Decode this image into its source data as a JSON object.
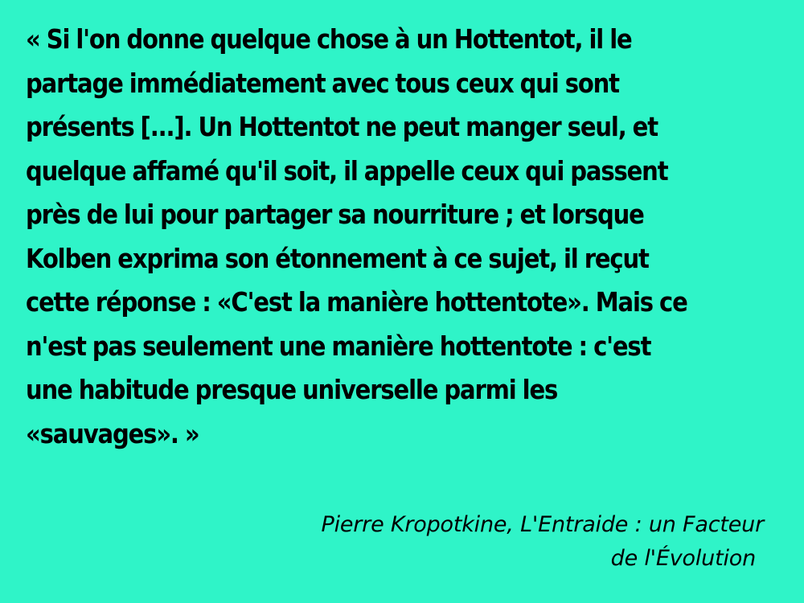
{
  "slide": {
    "background_color": "#2ff4c8",
    "text_color": "#000000",
    "quote_lines": [
      "« Si l'on donne quelque chose à un Hottentot, il le",
      "partage immédiatement avec tous ceux qui sont",
      "présents [...]. Un Hottentot ne peut manger seul, et",
      "quelque affamé qu'il soit, il appelle ceux qui passent",
      "près de lui pour partager sa nourriture ; et lorsque",
      "Kolben exprima son étonnement à ce sujet, il reçut",
      "cette réponse : «C'est la manière hottentote». Mais ce",
      "n'est pas seulement une manière hottentote : c'est",
      "une habitude presque universelle parmi les",
      "«sauvages». »"
    ],
    "attribution_lines": [
      "Pierre Kropotkine, L'Entraide : un Facteur",
      "de l'Évolution"
    ]
  }
}
